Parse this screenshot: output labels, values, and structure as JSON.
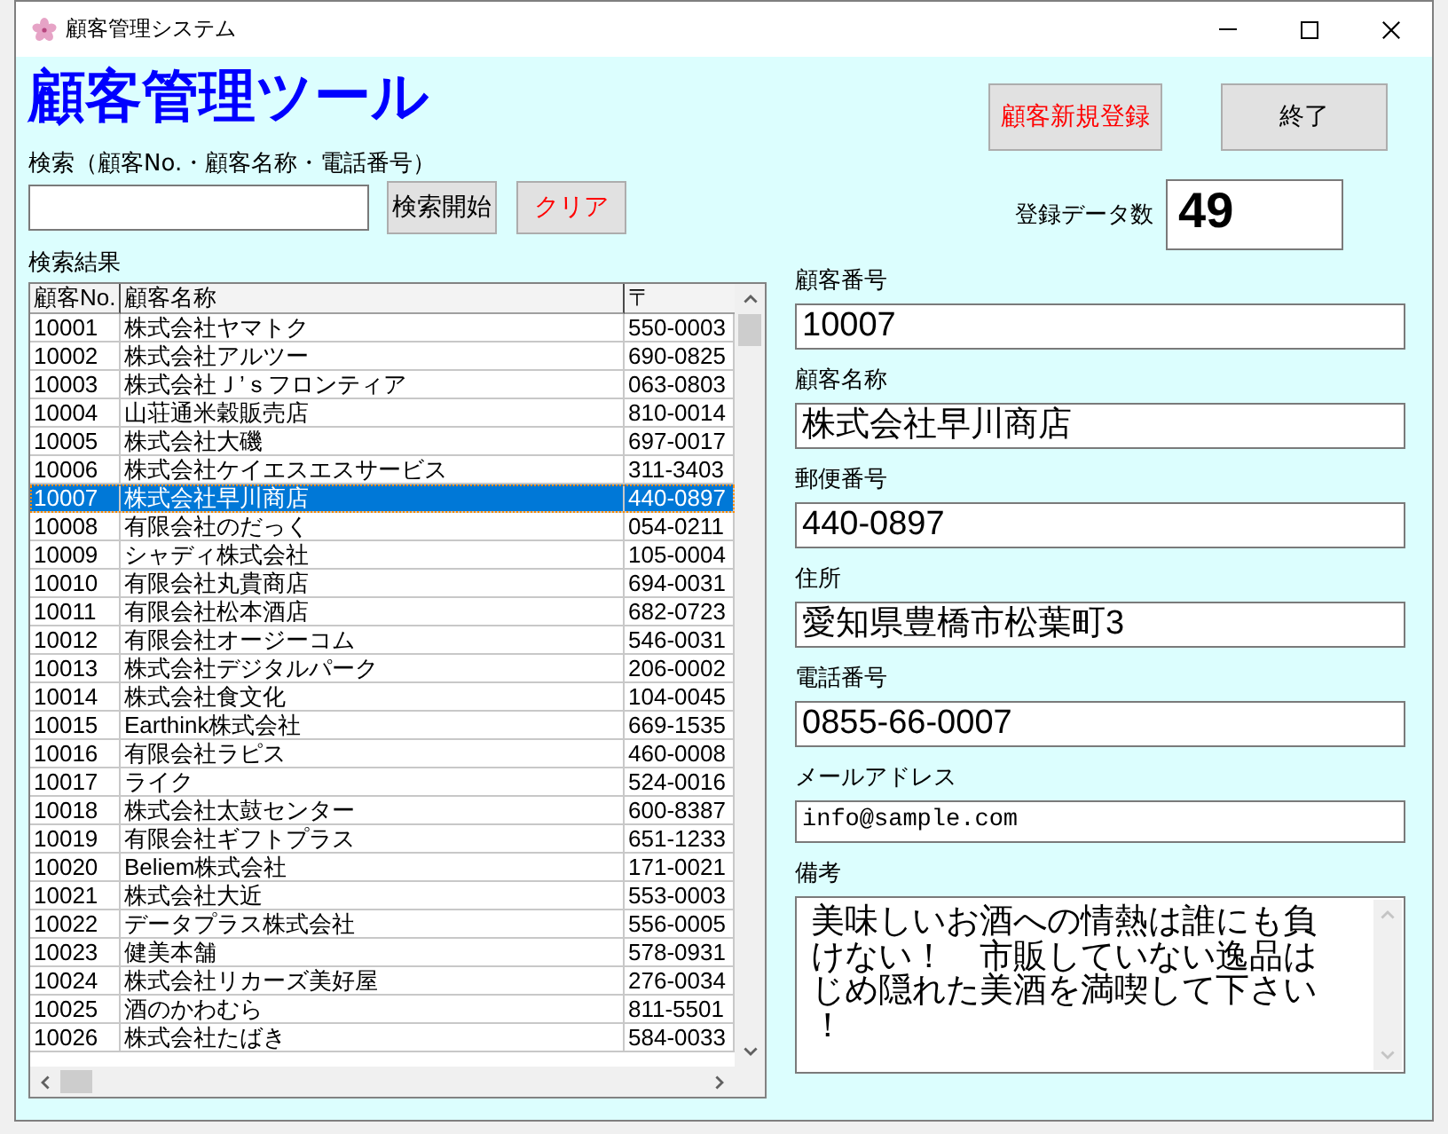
{
  "window": {
    "title": "顧客管理システム"
  },
  "header": {
    "title": "顧客管理ツール"
  },
  "search": {
    "label": "検索（顧客No.・顧客名称・電話番号）",
    "buttons": [
      {
        "label": "検索開始",
        "kind": "normal"
      },
      {
        "label": "クリア",
        "kind": "danger"
      }
    ]
  },
  "results": {
    "label": "検索結果",
    "columns": [
      "顧客No.",
      "顧客名称",
      "〒"
    ],
    "rows": [
      {
        "cells": [
          "10001",
          "株式会社ヤマトク",
          "550-0003"
        ],
        "selected": false
      },
      {
        "cells": [
          "10002",
          "株式会社アルツー",
          "690-0825"
        ],
        "selected": false
      },
      {
        "cells": [
          "10003",
          "株式会社Ｊ’ｓフロンティア",
          "063-0803"
        ],
        "selected": false
      },
      {
        "cells": [
          "10004",
          "山荘通米穀販売店",
          "810-0014"
        ],
        "selected": false
      },
      {
        "cells": [
          "10005",
          "株式会社大磯",
          "697-0017"
        ],
        "selected": false
      },
      {
        "cells": [
          "10006",
          "株式会社ケイエスエスサービス",
          "311-3403"
        ],
        "selected": false
      },
      {
        "cells": [
          "10007",
          "株式会社早川商店",
          "440-0897"
        ],
        "selected": true
      },
      {
        "cells": [
          "10008",
          "有限会社のだっく",
          "054-0211"
        ],
        "selected": false
      },
      {
        "cells": [
          "10009",
          "シャディ株式会社",
          "105-0004"
        ],
        "selected": false
      },
      {
        "cells": [
          "10010",
          "有限会社丸貴商店",
          "694-0031"
        ],
        "selected": false
      },
      {
        "cells": [
          "10011",
          "有限会社松本酒店",
          "682-0723"
        ],
        "selected": false
      },
      {
        "cells": [
          "10012",
          "有限会社オージーコム",
          "546-0031"
        ],
        "selected": false
      },
      {
        "cells": [
          "10013",
          "株式会社デジタルパーク",
          "206-0002"
        ],
        "selected": false
      },
      {
        "cells": [
          "10014",
          "株式会社食文化",
          "104-0045"
        ],
        "selected": false
      },
      {
        "cells": [
          "10015",
          "Earthink株式会社",
          "669-1535"
        ],
        "selected": false
      },
      {
        "cells": [
          "10016",
          "有限会社ラピス",
          "460-0008"
        ],
        "selected": false
      },
      {
        "cells": [
          "10017",
          "ライク",
          "524-0016"
        ],
        "selected": false
      },
      {
        "cells": [
          "10018",
          "株式会社太鼓センター",
          "600-8387"
        ],
        "selected": false
      },
      {
        "cells": [
          "10019",
          "有限会社ギフトプラス",
          "651-1233"
        ],
        "selected": false
      },
      {
        "cells": [
          "10020",
          "Beliem株式会社",
          "171-0021"
        ],
        "selected": false
      },
      {
        "cells": [
          "10021",
          "株式会社大近",
          "553-0003"
        ],
        "selected": false
      },
      {
        "cells": [
          "10022",
          "データプラス株式会社",
          "556-0005"
        ],
        "selected": false
      },
      {
        "cells": [
          "10023",
          "健美本舗",
          "578-0931"
        ],
        "selected": false
      },
      {
        "cells": [
          "10024",
          "株式会社リカーズ美好屋",
          "276-0034"
        ],
        "selected": false
      },
      {
        "cells": [
          "10025",
          "酒のかわむら",
          "811-5501"
        ],
        "selected": false
      },
      {
        "cells": [
          "10026",
          "株式会社たばき",
          "584-0033"
        ],
        "selected": false
      }
    ]
  },
  "actions": [
    {
      "label": "顧客新規登録",
      "kind": "danger"
    },
    {
      "label": "終了",
      "kind": "normal"
    }
  ],
  "count": {
    "label": "登録データ数",
    "value": "49"
  },
  "details": [
    {
      "label": "顧客番号",
      "value": "10007",
      "kind": "text"
    },
    {
      "label": "顧客名称",
      "value": "株式会社早川商店",
      "kind": "text"
    },
    {
      "label": "郵便番号",
      "value": "440-0897",
      "kind": "text"
    },
    {
      "label": "住所",
      "value": "愛知県豊橋市松葉町3",
      "kind": "text"
    },
    {
      "label": "電話番号",
      "value": "0855-66-0007",
      "kind": "text"
    },
    {
      "label": "メールアドレス",
      "value": "info@sample.com",
      "kind": "compact"
    },
    {
      "label": "備考",
      "value": "美味しいお酒への情熱は誰にも負けない！　市販していない逸品はじめ隠れた美酒を満喫して下さい！",
      "kind": "multiline"
    }
  ]
}
